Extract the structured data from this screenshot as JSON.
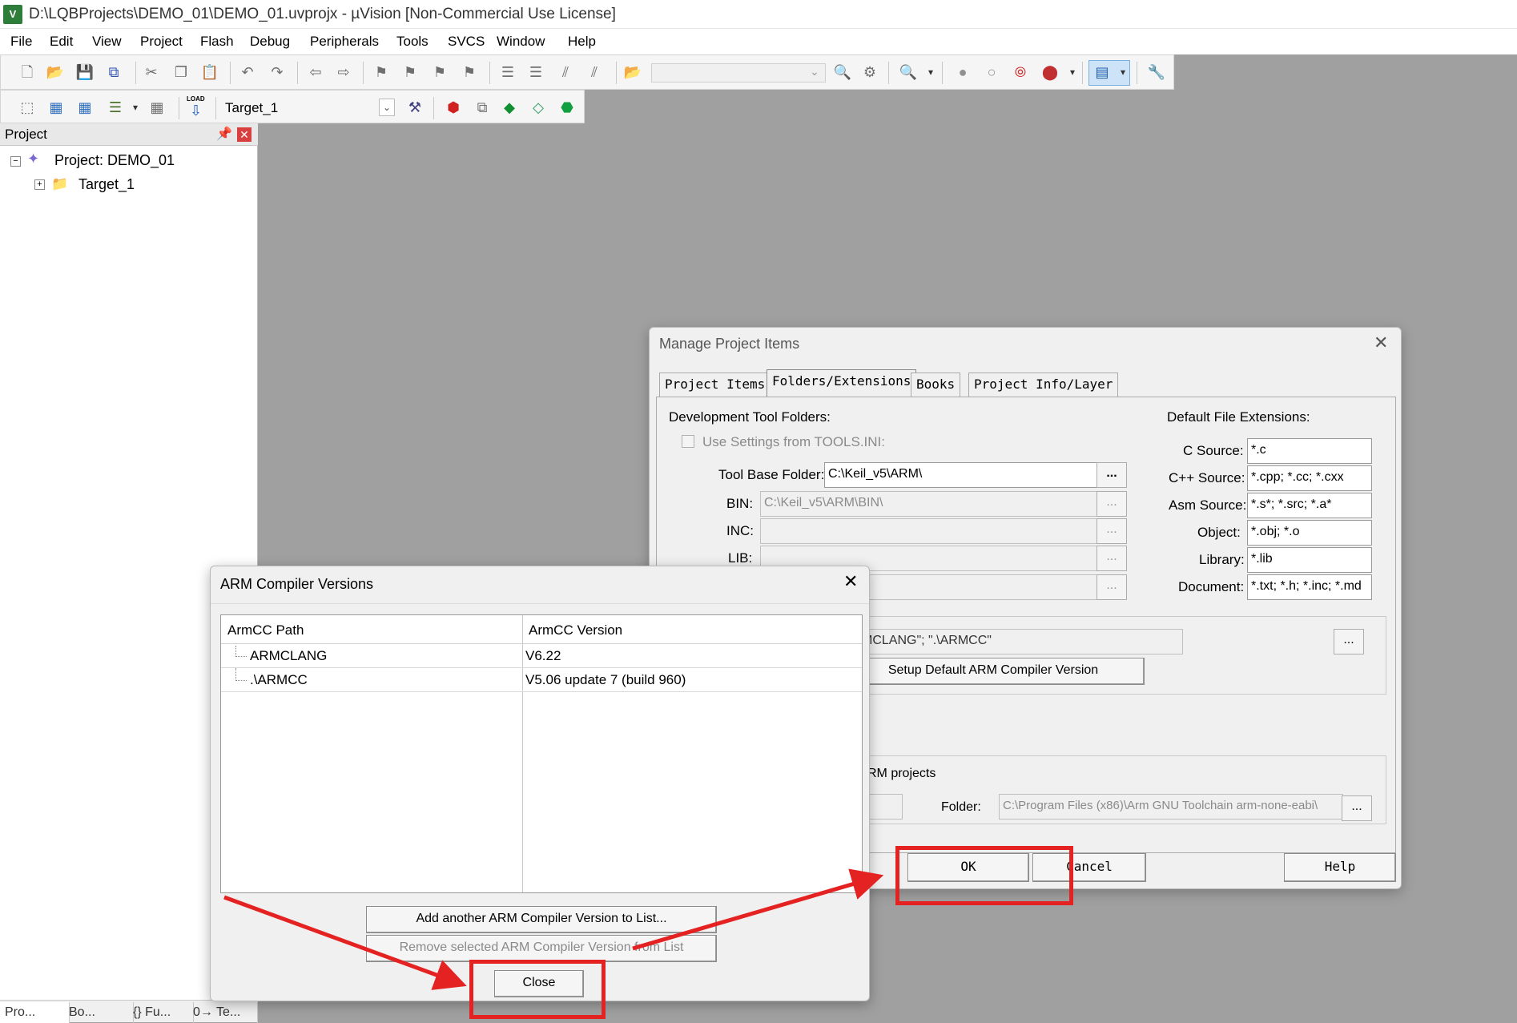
{
  "window": {
    "title": "D:\\LQBProjects\\DEMO_01\\DEMO_01.uvprojx - µVision  [Non-Commercial Use License]",
    "icon_label": "V"
  },
  "menu": [
    "File",
    "Edit",
    "View",
    "Project",
    "Flash",
    "Debug",
    "Peripherals",
    "Tools",
    "SVCS",
    "Window",
    "Help"
  ],
  "toolbar2": {
    "target": "Target_1",
    "load_label": "LOAD"
  },
  "project_panel": {
    "header": "Project",
    "tree": {
      "root": "Project: DEMO_01",
      "child": "Target_1"
    },
    "bottom_tabs": [
      "Pro...",
      "Bo...",
      "{} Fu...",
      "0→ Te..."
    ]
  },
  "manage_dialog": {
    "title": "Manage Project Items",
    "tabs": [
      "Project Items",
      "Folders/Extensions",
      "Books",
      "Project Info/Layer"
    ],
    "dev_tool_folders": "Development Tool Folders:",
    "use_settings": "Use Settings from TOOLS.INI:",
    "tool_base_label": "Tool Base Folder:",
    "tool_base_value": "C:\\Keil_v5\\ARM\\",
    "bin_label": "BIN:",
    "bin_value": "C:\\Keil_v5\\ARM\\BIN\\",
    "inc_label": "INC:",
    "lib_label": "LIB:",
    "dots": "...",
    "default_ext": "Default File Extensions:",
    "c_source_label": "C Source:",
    "c_source_value": "*.c",
    "cpp_source_label": "C++ Source:",
    "cpp_source_value": "*.cpp; *.cc; *.cxx",
    "asm_source_label": "Asm Source:",
    "asm_source_value": "*.s*; *.src; *.a*",
    "object_label": "Object:",
    "object_value": "*.obj; *.o",
    "library_label": "Library:",
    "library_value": "*.lib",
    "document_label": "Document:",
    "document_value": "*.txt; *.h; *.inc; *.md",
    "compiler_list_value": "MCLANG\"; \".\\ARMCC\"",
    "setup_default_button": "Setup Default ARM Compiler Version",
    "arm_projects_label": "RM projects",
    "folder_label": "Folder:",
    "folder_value": "C:\\Program Files (x86)\\Arm GNU Toolchain arm-none-eabi\\",
    "ok_button": "OK",
    "cancel_button": "Cancel",
    "help_button": "Help"
  },
  "arm_dialog": {
    "title": "ARM Compiler Versions",
    "col_path": "ArmCC Path",
    "col_version": "ArmCC Version",
    "rows": [
      {
        "path": "ARMCLANG",
        "version": "V6.22"
      },
      {
        "path": ".\\ARMCC",
        "version": "V5.06 update 7 (build 960)"
      }
    ],
    "add_button": "Add another ARM Compiler Version to List...",
    "remove_button": "Remove selected ARM Compiler Version from List",
    "close_button": "Close"
  },
  "colors": {
    "annotation": "#e52222",
    "workspace": "#a0a0a0"
  }
}
